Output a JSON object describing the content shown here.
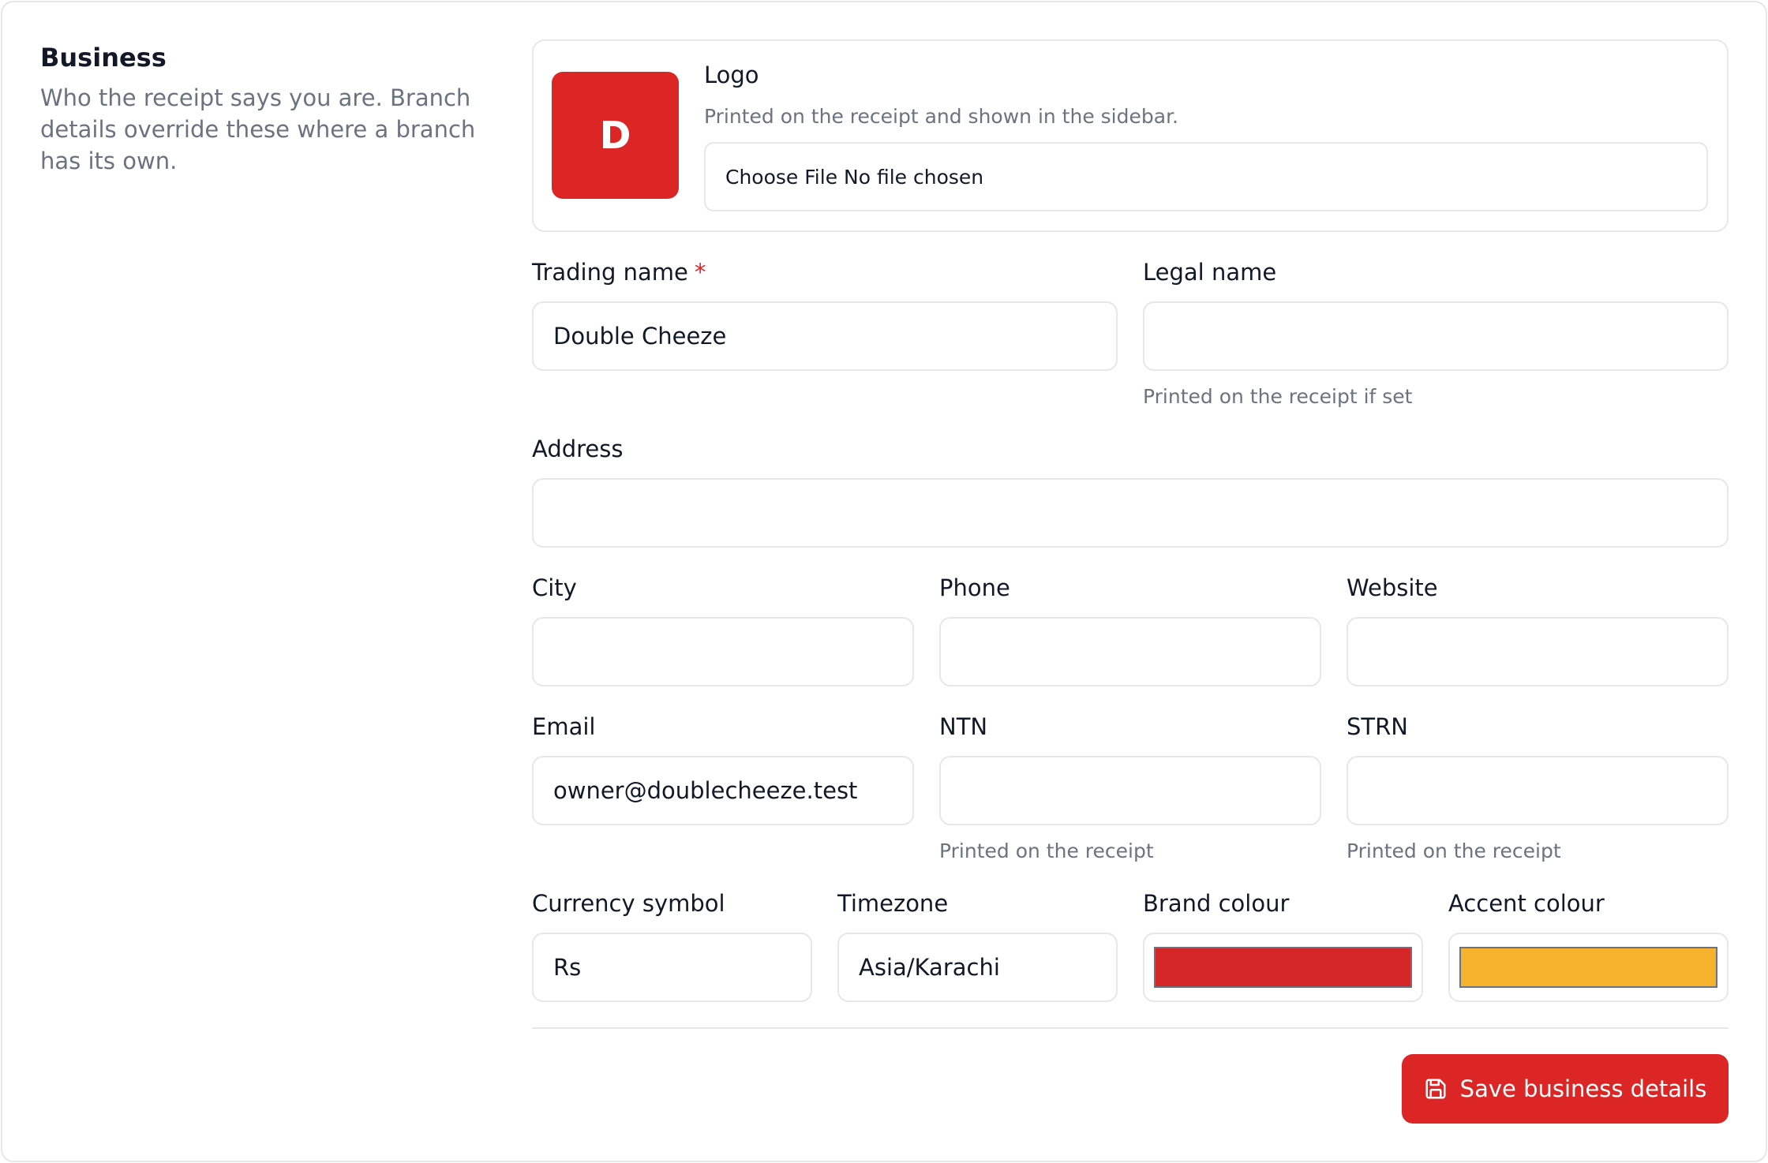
{
  "section": {
    "title": "Business",
    "description": "Who the receipt says you are. Branch details override these where a branch has its own."
  },
  "logo": {
    "initial": "D",
    "label": "Logo",
    "hint": "Printed on the receipt and shown in the sidebar.",
    "file_input_text": "Choose File No file chosen"
  },
  "fields": {
    "trading_name": {
      "label": "Trading name",
      "required_marker": "*",
      "value": "Double Cheeze"
    },
    "legal_name": {
      "label": "Legal name",
      "value": "",
      "hint": "Printed on the receipt if set"
    },
    "address": {
      "label": "Address",
      "value": ""
    },
    "city": {
      "label": "City",
      "value": ""
    },
    "phone": {
      "label": "Phone",
      "value": ""
    },
    "website": {
      "label": "Website",
      "value": ""
    },
    "email": {
      "label": "Email",
      "value": "owner@doublecheeze.test"
    },
    "ntn": {
      "label": "NTN",
      "value": "",
      "hint": "Printed on the receipt"
    },
    "strn": {
      "label": "STRN",
      "value": "",
      "hint": "Printed on the receipt"
    },
    "currency_symbol": {
      "label": "Currency symbol",
      "value": "Rs"
    },
    "timezone": {
      "label": "Timezone",
      "value": "Asia/Karachi"
    },
    "brand_colour": {
      "label": "Brand colour",
      "color": "#d62728"
    },
    "accent_colour": {
      "label": "Accent colour",
      "color": "#f6b12d"
    }
  },
  "actions": {
    "save_label": "Save business details",
    "save_icon": "floppy-disk-icon"
  },
  "colors": {
    "accent": "#dc2626",
    "border": "#e5e7eb",
    "muted_text": "#6b7280"
  }
}
